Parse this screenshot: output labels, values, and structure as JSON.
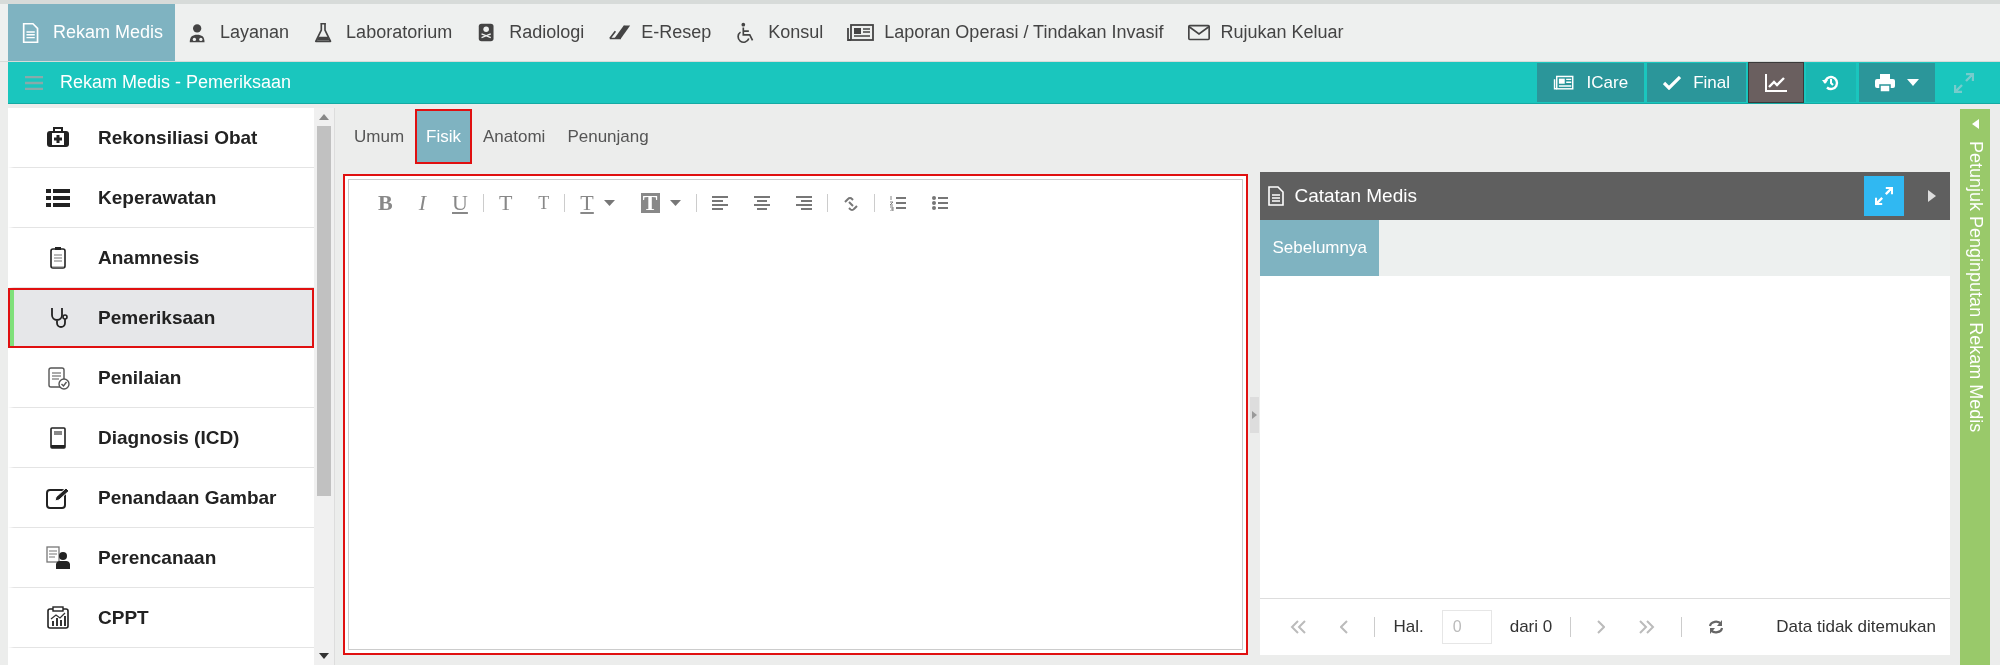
{
  "top_nav": [
    {
      "label": "Rekam Medis",
      "selected": true
    },
    {
      "label": "Layanan",
      "selected": false
    },
    {
      "label": "Laboratorium",
      "selected": false
    },
    {
      "label": "Radiologi",
      "selected": false
    },
    {
      "label": "E-Resep",
      "selected": false
    },
    {
      "label": "Konsul",
      "selected": false
    },
    {
      "label": "Laporan Operasi / Tindakan Invasif",
      "selected": false
    },
    {
      "label": "Rujukan Keluar",
      "selected": false
    }
  ],
  "header": {
    "title": "Rekam Medis - Pemeriksaan",
    "actions": [
      {
        "kind": "labeled",
        "label": "ICare",
        "selected": false,
        "disabled": false
      },
      {
        "kind": "labeled",
        "label": "Final",
        "selected": false,
        "disabled": false
      },
      {
        "kind": "chart",
        "selected": true,
        "disabled": false
      },
      {
        "kind": "history",
        "selected": false,
        "disabled": false
      },
      {
        "kind": "print",
        "selected": false,
        "disabled": false
      },
      {
        "kind": "expand",
        "selected": false,
        "disabled": true
      }
    ]
  },
  "sidebar": {
    "items": [
      {
        "label": "Rekonsiliasi Obat",
        "selected": false
      },
      {
        "label": "Keperawatan",
        "selected": false
      },
      {
        "label": "Anamnesis",
        "selected": false
      },
      {
        "label": "Pemeriksaan",
        "selected": true
      },
      {
        "label": "Penilaian",
        "selected": false
      },
      {
        "label": "Diagnosis (ICD)",
        "selected": false
      },
      {
        "label": "Penandaan Gambar",
        "selected": false
      },
      {
        "label": "Perencanaan",
        "selected": false
      },
      {
        "label": "CPPT",
        "selected": false
      }
    ]
  },
  "tabs": [
    {
      "label": "Umum",
      "selected": false
    },
    {
      "label": "Fisik",
      "selected": true
    },
    {
      "label": "Anatomi",
      "selected": false
    },
    {
      "label": "Penunjang",
      "selected": false
    }
  ],
  "editor": {
    "focused": true,
    "toolbar": [
      {
        "kind": "bold",
        "label": "B"
      },
      {
        "kind": "italic",
        "label": "I"
      },
      {
        "kind": "underline",
        "label": "U"
      },
      {
        "kind": "separator"
      },
      {
        "kind": "superscript",
        "label": "T"
      },
      {
        "kind": "subscript",
        "label": "T"
      },
      {
        "kind": "separator"
      },
      {
        "kind": "font-color",
        "label": "T"
      },
      {
        "kind": "highlight",
        "label": "T"
      },
      {
        "kind": "separator"
      },
      {
        "kind": "align-left"
      },
      {
        "kind": "align-center"
      },
      {
        "kind": "align-right"
      },
      {
        "kind": "separator"
      },
      {
        "kind": "link"
      },
      {
        "kind": "separator"
      },
      {
        "kind": "ordered-list"
      },
      {
        "kind": "bullet-list"
      }
    ]
  },
  "notes_panel": {
    "title": "Catatan Medis",
    "tabs": [
      {
        "label": "Sebelumnya",
        "selected": true
      }
    ],
    "pager": {
      "page_label": "Hal.",
      "page_placeholder": "0",
      "total": "dari 0",
      "status": "Data tidak ditemukan"
    }
  },
  "side_strip": {
    "label": "Petunjuk Penginputan Rekam Medis"
  }
}
